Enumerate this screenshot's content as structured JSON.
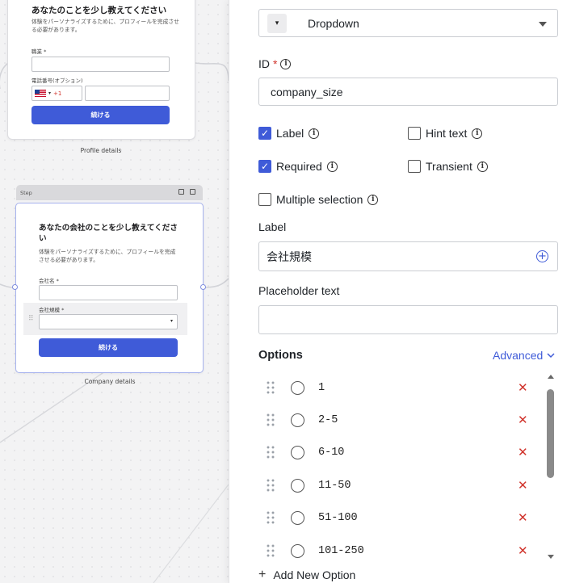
{
  "canvas": {
    "card1": {
      "title": "あなたのことを少し教えてください",
      "subtitle": "体験をパーソナライズするために、プロフィールを完成させる必要があります。",
      "occupation_label": "職業 *",
      "phone_label": "電話番号(オプション)",
      "dial_code": "+1",
      "button": "続ける",
      "caption": "Profile details"
    },
    "step": {
      "label": "Step"
    },
    "card2": {
      "title": "あなたの会社のことを少し教えてください",
      "subtitle": "体験をパーソナライズするために、プロフィールを完成させる必要があります。",
      "company_name_label": "会社名 *",
      "company_size_label": "会社規模 *",
      "button": "続ける",
      "caption": "Company details"
    }
  },
  "panel": {
    "type_select": {
      "icon": "dropdown-type-icon",
      "value": "Dropdown"
    },
    "id_field": {
      "label": "ID",
      "required_mark": "*",
      "value": "company_size"
    },
    "checkboxes": {
      "label": {
        "text": "Label",
        "checked": true
      },
      "hint_text": {
        "text": "Hint text",
        "checked": false
      },
      "required": {
        "text": "Required",
        "checked": true
      },
      "transient": {
        "text": "Transient",
        "checked": false
      },
      "multiple_selection": {
        "text": "Multiple selection",
        "checked": false
      }
    },
    "label_field": {
      "label": "Label",
      "value": "会社規模"
    },
    "placeholder_field": {
      "label": "Placeholder text",
      "value": ""
    },
    "options": {
      "title": "Options",
      "advanced": "Advanced",
      "items": [
        "1",
        "2-5",
        "6-10",
        "11-50",
        "51-100",
        "101-250"
      ],
      "add_label": "Add New Option"
    }
  },
  "colors": {
    "accent": "#3f5bd8",
    "danger": "#d0342c"
  }
}
